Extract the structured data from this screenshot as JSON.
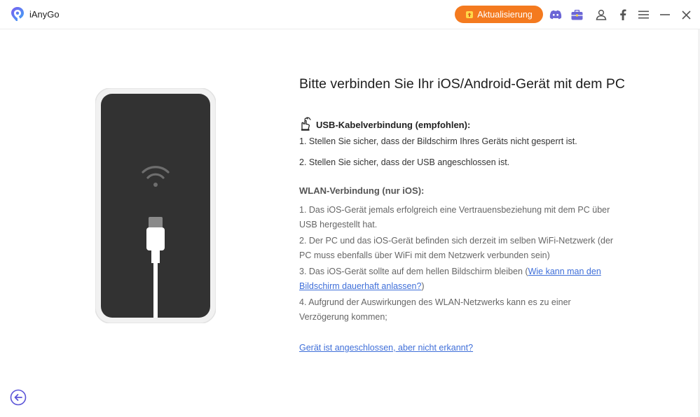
{
  "app": {
    "name": "iAnyGo"
  },
  "header": {
    "update_label": "Aktualisierung",
    "icons": [
      "discord-icon",
      "toolbox-icon",
      "user-icon",
      "facebook-icon",
      "menu-icon",
      "minimize-icon",
      "close-icon"
    ]
  },
  "main": {
    "title": "Bitte verbinden Sie Ihr iOS/Android-Gerät mit dem PC",
    "usb": {
      "heading": "USB-Kabelverbindung (empfohlen):",
      "steps": [
        "1. Stellen Sie sicher, dass der Bildschirm Ihres Geräts nicht gesperrt ist.",
        "2. Stellen Sie sicher, dass der USB angeschlossen ist."
      ]
    },
    "wlan": {
      "heading": "WLAN-Verbindung (nur iOS):",
      "step1_line1": "1. Das iOS-Gerät jemals erfolgreich eine Vertrauensbeziehung mit dem PC über",
      "step1_line2": "USB hergestellt hat.",
      "step2_line1": "2. Der PC und das iOS-Gerät befinden sich derzeit im selben WiFi-Netzwerk (der",
      "step2_line2": "PC muss ebenfalls über WiFi mit dem Netzwerk verbunden sein)",
      "step3_text": "3. Das iOS-Gerät sollte auf dem hellen Bildschirm bleiben",
      "step3_paren_open": "(",
      "step3_link_line1": "Wie kann man den",
      "step3_link_line2": "Bildschirm dauerhaft anlassen?",
      "step3_paren_close": ")",
      "step4_line1": "4. Aufgrund der Auswirkungen des WLAN-Netzwerks kann es zu einer",
      "step4_line2": "Verzögerung kommen;"
    },
    "help_link": "Gerät ist angeschlossen, aber nicht erkannt?"
  },
  "colors": {
    "accent": "#f47a1f",
    "link": "#3f6fd9",
    "icon": "#6b66d6",
    "phone_screen": "#323232"
  }
}
